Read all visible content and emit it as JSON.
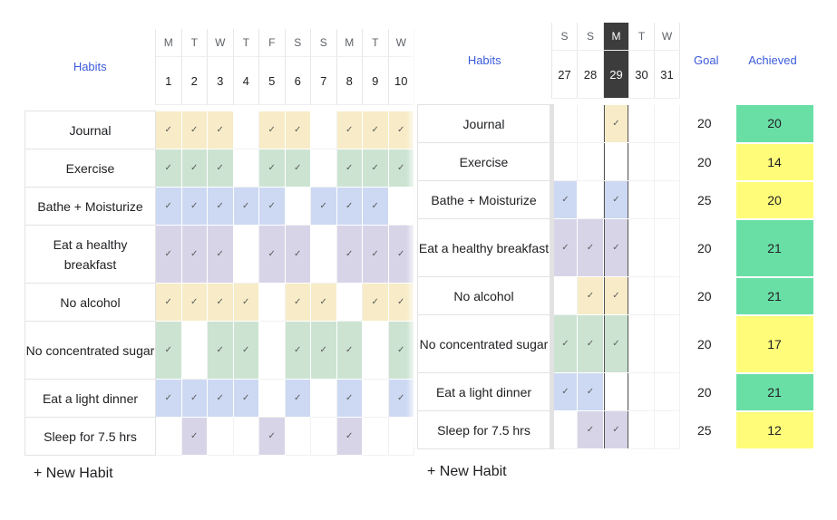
{
  "colors": {
    "yellow": "#f7ecc7",
    "green": "#cce3d2",
    "blue": "#cdd9f3",
    "purple": "#d8d4e8",
    "empty": "#ffffff",
    "achieved_high": "#69dfa6",
    "achieved_low": "#fffc7a",
    "link_blue": "#3b5bdb"
  },
  "check_glyph": "✓",
  "habits_header": "Habits",
  "goal_header": "Goal",
  "achieved_header": "Achieved",
  "new_habit_label": "+ New Habit",
  "left_panel": {
    "days": [
      {
        "dow": "M",
        "num": "1"
      },
      {
        "dow": "T",
        "num": "2"
      },
      {
        "dow": "W",
        "num": "3"
      },
      {
        "dow": "T",
        "num": "4"
      },
      {
        "dow": "F",
        "num": "5"
      },
      {
        "dow": "S",
        "num": "6"
      },
      {
        "dow": "S",
        "num": "7"
      },
      {
        "dow": "M",
        "num": "8"
      },
      {
        "dow": "T",
        "num": "9"
      },
      {
        "dow": "W",
        "num": "10"
      }
    ]
  },
  "right_panel": {
    "days": [
      {
        "dow": "S",
        "num": "27",
        "today": false
      },
      {
        "dow": "S",
        "num": "28",
        "today": false
      },
      {
        "dow": "M",
        "num": "29",
        "today": true
      },
      {
        "dow": "T",
        "num": "30",
        "today": false
      },
      {
        "dow": "W",
        "num": "31",
        "today": false
      }
    ]
  },
  "habits": [
    {
      "name": "Journal",
      "color": "yellow",
      "goal": "20",
      "achieved": "20",
      "achieved_status": "high",
      "left": [
        1,
        1,
        1,
        0,
        1,
        1,
        0,
        1,
        1,
        1
      ],
      "right": [
        0,
        0,
        1,
        0,
        0
      ]
    },
    {
      "name": "Exercise",
      "color": "green",
      "goal": "20",
      "achieved": "14",
      "achieved_status": "low",
      "left": [
        1,
        1,
        1,
        0,
        1,
        1,
        0,
        1,
        1,
        1
      ],
      "right": [
        0,
        0,
        0,
        0,
        0
      ]
    },
    {
      "name": "Bathe + Moisturize",
      "color": "blue",
      "goal": "25",
      "achieved": "20",
      "achieved_status": "low",
      "left": [
        1,
        1,
        1,
        1,
        1,
        0,
        1,
        1,
        1,
        0
      ],
      "right": [
        1,
        0,
        1,
        0,
        0
      ]
    },
    {
      "name": "Eat a healthy breakfast",
      "color": "purple",
      "goal": "20",
      "achieved": "21",
      "achieved_status": "high",
      "left": [
        1,
        1,
        1,
        0,
        1,
        1,
        0,
        1,
        1,
        1
      ],
      "right": [
        1,
        1,
        1,
        0,
        0
      ]
    },
    {
      "name": "No alcohol",
      "color": "yellow",
      "goal": "20",
      "achieved": "21",
      "achieved_status": "high",
      "left": [
        1,
        1,
        1,
        1,
        0,
        1,
        1,
        0,
        1,
        1
      ],
      "right": [
        0,
        1,
        1,
        0,
        0
      ]
    },
    {
      "name": "No concentrated sugar",
      "color": "green",
      "goal": "20",
      "achieved": "17",
      "achieved_status": "low",
      "left": [
        1,
        0,
        1,
        1,
        0,
        1,
        1,
        1,
        0,
        1
      ],
      "right": [
        1,
        1,
        1,
        0,
        0
      ]
    },
    {
      "name": "Eat a light dinner",
      "color": "blue",
      "goal": "20",
      "achieved": "21",
      "achieved_status": "high",
      "left": [
        1,
        1,
        1,
        1,
        0,
        1,
        0,
        1,
        0,
        1
      ],
      "right": [
        1,
        1,
        0,
        0,
        0
      ]
    },
    {
      "name": "Sleep for 7.5 hrs",
      "color": "purple",
      "goal": "25",
      "achieved": "12",
      "achieved_status": "low",
      "left": [
        0,
        1,
        0,
        0,
        1,
        0,
        0,
        1,
        0,
        0
      ],
      "right": [
        0,
        1,
        1,
        0,
        0
      ]
    }
  ]
}
